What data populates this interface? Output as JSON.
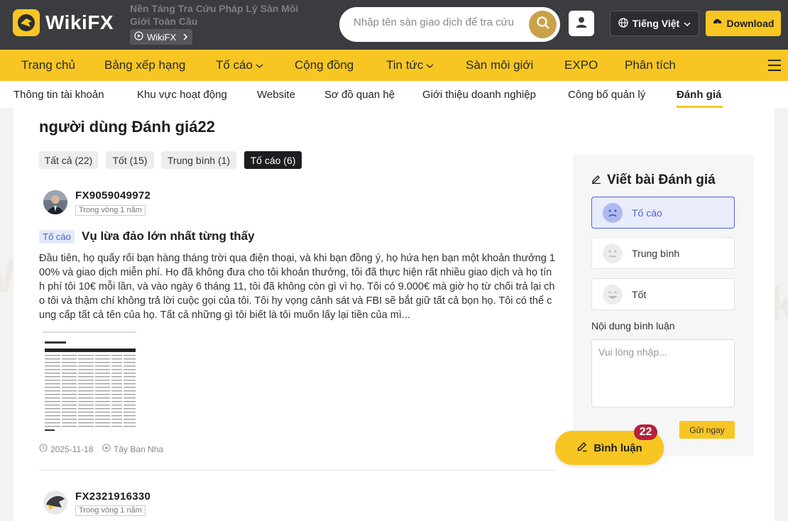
{
  "brand": {
    "name": "WikiFX",
    "tagline": "Nền Tảng Tra Cứu Pháp Lý Sàn Môi Giới Toàn Cầu",
    "app_label": "WikiFX"
  },
  "header": {
    "search_placeholder": "Nhập tên sàn giao dịch để tra cứu",
    "language": "Tiếng Việt",
    "download": "Download"
  },
  "main_nav": [
    {
      "label": "Trang chủ"
    },
    {
      "label": "Bảng xếp hạng"
    },
    {
      "label": "Tố cáo"
    },
    {
      "label": "Cộng đồng"
    },
    {
      "label": "Tin tức"
    },
    {
      "label": "Sàn môi giới"
    },
    {
      "label": "EXPO"
    },
    {
      "label": "Phân tích"
    }
  ],
  "sub_nav": [
    {
      "label": "Thông tin tài khoản"
    },
    {
      "label": "Khu vực hoạt động"
    },
    {
      "label": "Website"
    },
    {
      "label": "Sơ đồ quan hệ"
    },
    {
      "label": "Giới thiệu doanh nghiệp"
    },
    {
      "label": "Công bố quản lý"
    },
    {
      "label": "Đánh giá"
    }
  ],
  "page_title": "người dùng Đánh giá22",
  "filters": [
    {
      "label": "Tất cả (22)"
    },
    {
      "label": "Tốt (15)"
    },
    {
      "label": "Trung bình (1)"
    },
    {
      "label": "Tố cáo (6)"
    }
  ],
  "reviews": [
    {
      "user": "FX9059049972",
      "time": "Trong vòng 1 năm",
      "tag": "Tố cáo",
      "title": "Vụ lừa đảo lớn nhất từng thấy",
      "body": "Đầu tiên, họ quấy rối bạn hàng tháng trời qua điện thoại, và khi bạn đồng ý, họ hứa hẹn bạn một khoản thưởng 100% và giao dịch miễn phí. Họ đã không đưa cho tôi khoản thưởng, tôi đã thực hiện rất nhiều giao dịch và họ tính phí tôi 10€ mỗi lần, và vào ngày 6 tháng 11, tôi đã không còn gì vì họ. Tôi có 9.000€ mà giờ họ từ chối trả lại cho tôi và thậm chí không trả lời cuộc gọi của tôi. Tôi hy vọng cảnh sát và FBI sẽ bắt giữ tất cả bọn họ. Tôi có thể cung cấp tất cả tên của họ. Tất cả những gì tôi biết là tôi muốn lấy lại tiền của mì...",
      "date": "2025-11-18",
      "location": "Tây Ban Nha"
    },
    {
      "user": "FX2321916330",
      "time": "Trong vòng 1 năm"
    }
  ],
  "sidebar": {
    "title": "Viết bài Đánh giá",
    "options": [
      {
        "label": "Tố cáo"
      },
      {
        "label": "Trung bình"
      },
      {
        "label": "Tốt"
      }
    ],
    "comment_label": "Nội dung bình luận",
    "comment_placeholder": "Vui lòng nhập...",
    "send": "Gửi ngay"
  },
  "float": {
    "label": "Bình luận",
    "count": "22"
  },
  "colors": {
    "brand_yellow": "#f7c623",
    "header_dark": "#3a3c40",
    "complaint_blue": "#4b63d8",
    "badge_red": "#b5223a"
  },
  "icons": [
    "eagle-logo-icon",
    "play-circle-icon",
    "chevron-right-icon",
    "search-icon",
    "user-icon",
    "globe-icon",
    "chevron-down-icon",
    "download-icon",
    "menu-icon",
    "pencil-icon",
    "sad-face-icon",
    "neutral-face-icon",
    "happy-face-icon",
    "clock-icon",
    "location-icon"
  ]
}
